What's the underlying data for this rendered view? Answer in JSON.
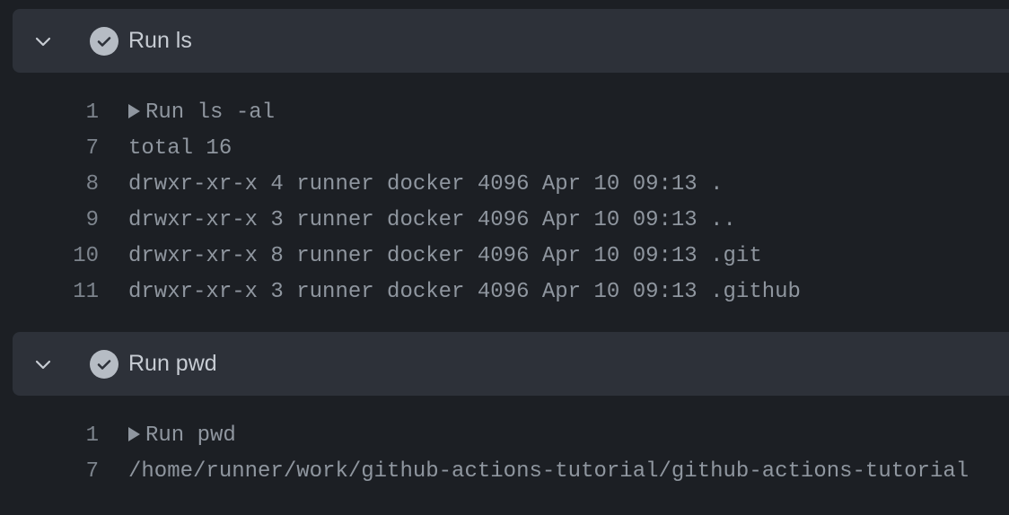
{
  "steps": [
    {
      "title": "Run ls",
      "status_icon": "check-circle-icon",
      "lines": [
        {
          "num": "1",
          "text": "Run ls -al",
          "collapsible": true
        },
        {
          "num": "7",
          "text": "total 16"
        },
        {
          "num": "8",
          "text": "drwxr-xr-x 4 runner docker 4096 Apr 10 09:13 ."
        },
        {
          "num": "9",
          "text": "drwxr-xr-x 3 runner docker 4096 Apr 10 09:13 .."
        },
        {
          "num": "10",
          "text": "drwxr-xr-x 8 runner docker 4096 Apr 10 09:13 .git"
        },
        {
          "num": "11",
          "text": "drwxr-xr-x 3 runner docker 4096 Apr 10 09:13 .github"
        }
      ]
    },
    {
      "title": "Run pwd",
      "status_icon": "check-circle-icon",
      "lines": [
        {
          "num": "1",
          "text": "Run pwd",
          "collapsible": true
        },
        {
          "num": "7",
          "text": "/home/runner/work/github-actions-tutorial/github-actions-tutorial"
        }
      ]
    }
  ],
  "colors": {
    "background": "#1c1f24",
    "header": "#2d3139",
    "check": "#b6bcc4"
  }
}
